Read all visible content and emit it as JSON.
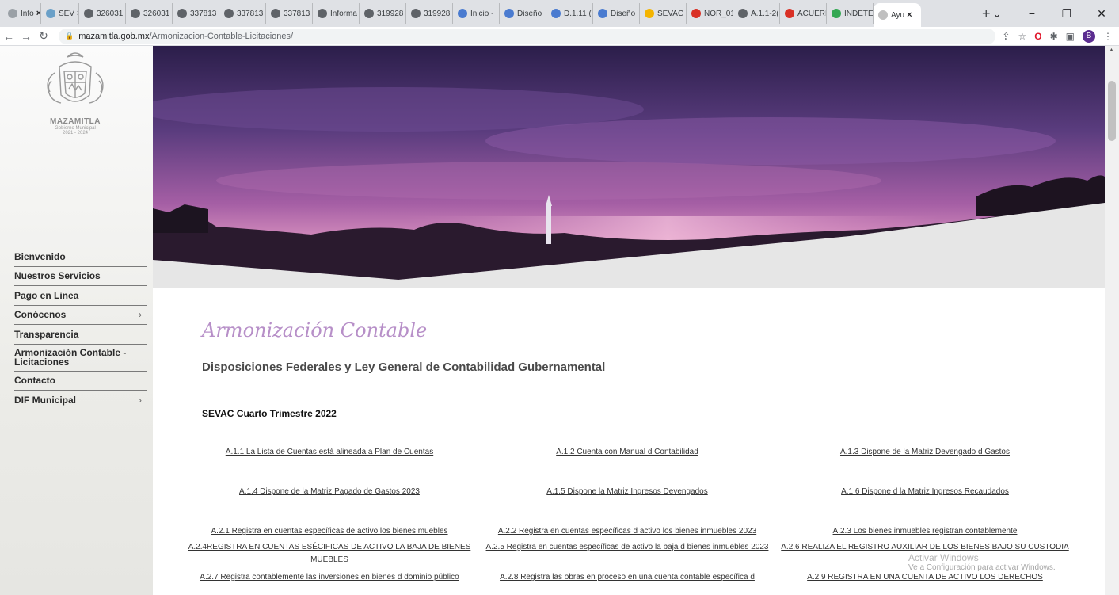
{
  "browser": {
    "tabs": [
      {
        "label": "Info",
        "color": "#9aa0a6"
      },
      {
        "label": "SEV",
        "color": "#6aa0c8"
      },
      {
        "label": "326031",
        "color": "#5f6368"
      },
      {
        "label": "326031",
        "color": "#5f6368"
      },
      {
        "label": "337813",
        "color": "#5f6368"
      },
      {
        "label": "337813",
        "color": "#5f6368"
      },
      {
        "label": "337813",
        "color": "#5f6368"
      },
      {
        "label": "Informa",
        "color": "#5f6368"
      },
      {
        "label": "319928",
        "color": "#5f6368"
      },
      {
        "label": "319928",
        "color": "#5f6368"
      },
      {
        "label": "Inicio -",
        "color": "#4a7bd0"
      },
      {
        "label": "Diseño",
        "color": "#4a7bd0"
      },
      {
        "label": "D.1.11 (",
        "color": "#4a7bd0"
      },
      {
        "label": "Diseño",
        "color": "#4a7bd0"
      },
      {
        "label": "SEVAC (",
        "color": "#f4b400"
      },
      {
        "label": "NOR_01",
        "color": "#d93025"
      },
      {
        "label": "A.1.1-2(",
        "color": "#5f6368"
      },
      {
        "label": "ACUERD",
        "color": "#d93025"
      },
      {
        "label": "INDETE",
        "color": "#34a853"
      },
      {
        "label": "Ayu",
        "color": "#c0c0c0",
        "active": true
      }
    ],
    "url_domain": "mazamitla.gob.mx",
    "url_path": "/Armonizacion-Contable-Licitaciones/"
  },
  "logo": {
    "name": "MAZAMITLA",
    "sub1": "Gobierno Municipal",
    "sub2": "2021 - 2024"
  },
  "menu": [
    {
      "label": "Bienvenido",
      "chevron": ""
    },
    {
      "label": "Nuestros Servicios",
      "chevron": ""
    },
    {
      "label": "Pago en Linea",
      "chevron": ""
    },
    {
      "label": "Conócenos",
      "chevron": "›"
    },
    {
      "label": "Transparencia",
      "chevron": ""
    },
    {
      "label": "Armonización Contable - Licitaciones",
      "chevron": ""
    },
    {
      "label": "Contacto",
      "chevron": ""
    },
    {
      "label": "DIF Municipal",
      "chevron": "›"
    }
  ],
  "content": {
    "script_title": "Armonización Contable",
    "subtitle": "Disposiciones Federales y Ley General de Contabilidad Gubernamental",
    "section": "SEVAC Cuarto Trimestre 2022"
  },
  "links": [
    [
      "A.1.1 La Lista de Cuentas está alineada a Plan de Cuentas",
      "A.1.2 Cuenta con Manual d Contabilidad",
      "A.1.3 Dispone de la Matriz Devengado d Gastos"
    ],
    [
      "A.1.4 Dispone de la Matriz Pagado de Gastos 2023",
      "A.1.5 Dispone la Matriz Ingresos Devengados",
      "A.1.6 Dispone d la Matriz Ingresos Recaudados"
    ],
    [
      "A.2.1 Registra en cuentas específicas de activo los bienes muebles",
      "A.2.2 Registra en cuentas específicas d activo los bienes inmuebles 2023",
      "A.2.3 Los bienes inmuebles registran contablemente"
    ],
    [
      "A.2.4REGISTRA EN CUENTAS ESÉCIFICAS DE ACTIVO LA BAJA DE BIENES MUEBLES",
      "A.2.5 Registra en cuentas específicas de activo la baja d bienes inmuebles 2023",
      "A.2.6 REALIZA EL REGISTRO AUXILIAR DE LOS BIENES BAJO SU CUSTODIA"
    ],
    [
      "A.2.7 Registra contablemente las inversiones en bienes d dominio público",
      "A.2.8 Registra las obras en proceso en una cuenta contable específica d",
      "A.2.9 REGISTRA EN UNA CUENTA DE ACTIVO LOS DERECHOS"
    ]
  ],
  "watermark": {
    "line1": "Activar Windows",
    "line2": "Ve a Configuración para activar Windows."
  }
}
